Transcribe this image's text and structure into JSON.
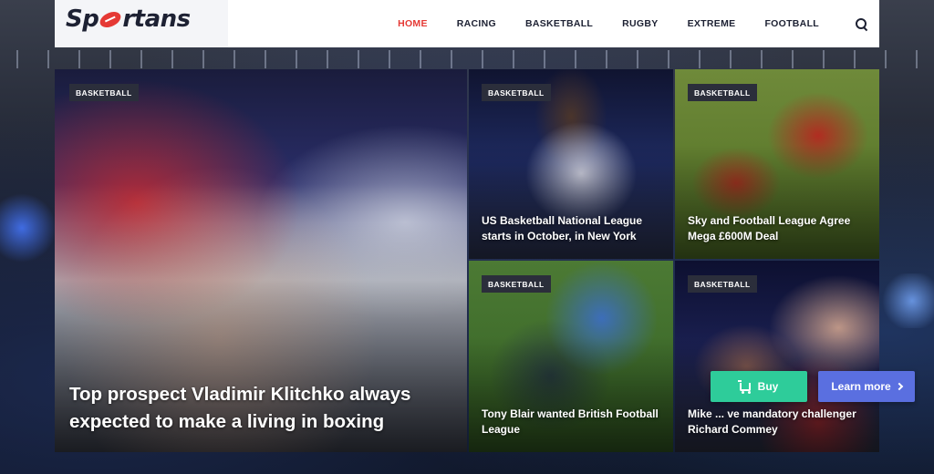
{
  "brand": {
    "logo_left": "Sp",
    "logo_right": "rtans"
  },
  "nav": {
    "items": [
      {
        "label": "HOME",
        "active": true
      },
      {
        "label": "RACING"
      },
      {
        "label": "BASKETBALL"
      },
      {
        "label": "RUGBY"
      },
      {
        "label": "EXTREME"
      },
      {
        "label": "FOOTBALL"
      }
    ]
  },
  "cards": [
    {
      "badge": "BASKETBALL",
      "title": "Top prospect Vladimir Klitchko always expected to make a living in boxing"
    },
    {
      "badge": "BASKETBALL",
      "title": "US Basketball National League starts in October, in New York"
    },
    {
      "badge": "BASKETBALL",
      "title": "Sky and Football League Agree Mega £600M Deal"
    },
    {
      "badge": "BASKETBALL",
      "title": "Tony Blair wanted British Football League"
    },
    {
      "badge": "BASKETBALL",
      "title": "Mike ... ve mandatory challenger Richard Commey"
    }
  ],
  "buttons": {
    "buy": "Buy",
    "learn_more": "Learn more"
  },
  "colors": {
    "accent": "#e53935",
    "buy": "#2ecc9a",
    "learn_more": "#5a6fe0",
    "badge_bg": "#2b2e3b"
  }
}
